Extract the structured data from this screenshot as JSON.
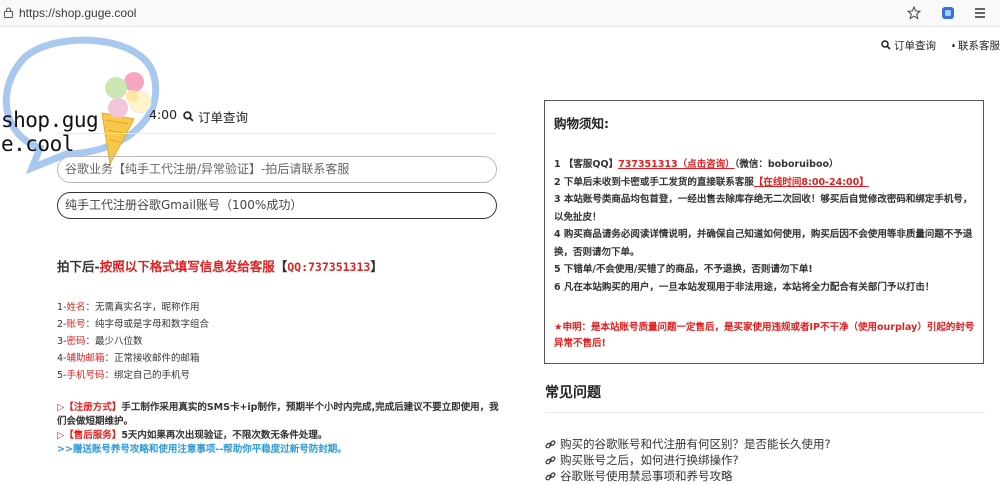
{
  "browser": {
    "url": "https://shop.guge.cool"
  },
  "topnav": {
    "order_query": "订单查询",
    "contact": "联系客服"
  },
  "logo": {
    "line1": "shop.gug",
    "line2": "e.cool"
  },
  "hours_fragment": "4:00",
  "order_query_label": "订单查询",
  "category_select": "谷歌业务【纯手工代注册/异常验证】-拍后请联系客服",
  "product_select": "纯手工代注册谷歌Gmail账号（100%成功）",
  "fill_title": {
    "prefix": "拍下后-",
    "red": "按照以下格式填写信息发给客服",
    "bracket_open": "【",
    "qq": "QQ:737351313",
    "bracket_close": "】"
  },
  "steps": [
    {
      "num": "1-",
      "label": "姓名",
      "text": "：无需真实名字，昵称作用"
    },
    {
      "num": "2-",
      "label": "账号",
      "text": "：纯字母或是字母和数字组合"
    },
    {
      "num": "3-",
      "label": "密码",
      "text": "：最少八位数"
    },
    {
      "num": "4-",
      "label": "辅助邮箱",
      "text": "：正常接收邮件的邮箱"
    },
    {
      "num": "5-",
      "label": "手机号码",
      "text": "：绑定自己的手机号"
    }
  ],
  "notes": {
    "reg_tag": "▷【注册方式】",
    "reg_text": "手工制作采用真实的SMS卡+ip制作，预期半个小时内完成,完成后建议不要立即使用，我们会做短期维护。",
    "after_tag": "▷【售后服务】",
    "after_text": "5天内如果再次出现验证，不限次数无条件处理。",
    "link": ">>赠送账号养号攻略和使用注意事项--帮助你平稳度过新号防封期。"
  },
  "notice": {
    "title": "购物须知:",
    "line1_a": "1 【客服QQ】",
    "line1_qq": "737351313（点击咨询）",
    "line1_b": "（微信：boboruiboo）",
    "line2_a": "2 下单后未收到卡密或手工发货的直接联系客服",
    "line2_red": "【在线时间8:00-24:00】",
    "line3": "3 本站账号类商品均包首登，一经出售去除库存绝无二次回收！够买后自觉修改密码和绑定手机号，以免扯皮！",
    "line4": "4 购买商品请务必阅读详情说明，并确保自己知道如何使用，购买后因不会使用等非质量问题不予退换，否则请勿下单。",
    "line5": "5 下错单/不会使用/买错了的商品，不予退换，否则请勿下单!",
    "line6": "6 凡在本站购买的用户，一旦本站发现用于非法用途，本站将全力配合有关部门予以打击！",
    "warning": "★申明：是本站账号质量问题一定售后，是买家使用违规或者IP不干净（使用ourplay）引起的封号异常不售后!"
  },
  "faq": {
    "title": "常见问题",
    "items": [
      "购买的谷歌账号和代注册有何区别？是否能长久使用?",
      "购买账号之后，如何进行换绑操作?",
      "谷歌账号使用禁忌事项和养号攻略"
    ]
  },
  "colors": {
    "accent_red": "#e02020",
    "link_blue": "#2f9bd8"
  },
  "icons": [
    "lock-icon",
    "star-icon",
    "extension-icon",
    "menu-icon",
    "search-icon",
    "qq-penguin-icon",
    "link-icon"
  ]
}
